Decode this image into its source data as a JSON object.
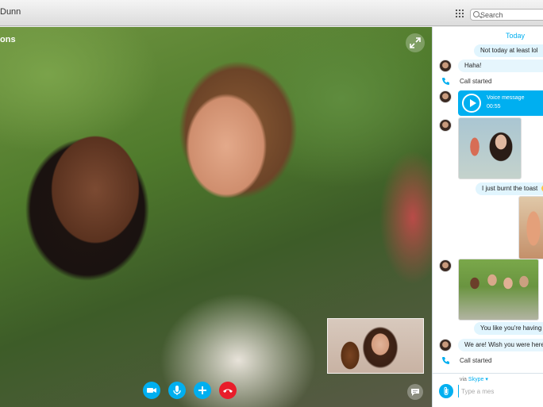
{
  "window": {
    "title": "Dunn"
  },
  "search": {
    "placeholder": "Search"
  },
  "call": {
    "caller_name_partial": "ons",
    "controls": [
      {
        "name": "video-toggle-button",
        "icon": "video-camera-icon",
        "color": "#00aff0"
      },
      {
        "name": "mute-button",
        "icon": "microphone-icon",
        "color": "#00aff0"
      },
      {
        "name": "add-button",
        "icon": "plus-icon",
        "color": "#00aff0"
      },
      {
        "name": "hang-up-button",
        "icon": "phone-hangup-icon",
        "color": "#e81d2a"
      }
    ]
  },
  "chat": {
    "day_label": "Today",
    "messages": [
      {
        "kind": "outgoing",
        "text": "Not today at least lol"
      },
      {
        "kind": "incoming",
        "text": "Haha!"
      },
      {
        "kind": "event",
        "text": "Call started"
      },
      {
        "kind": "voice",
        "title": "Voice message",
        "duration": "00:55"
      },
      {
        "kind": "outgoing",
        "text": "I just burnt the toast"
      },
      {
        "kind": "outgoing",
        "text": "You like you're having f"
      },
      {
        "kind": "incoming",
        "text": "We are! Wish you were here.."
      },
      {
        "kind": "event",
        "text": "Call started"
      }
    ],
    "composer": {
      "via_label": "via",
      "via_service": "Skype",
      "placeholder": "Type a mes"
    }
  },
  "colors": {
    "accent": "#00aff0",
    "hangup": "#e81d2a",
    "bubble": "#e1f5fe"
  }
}
